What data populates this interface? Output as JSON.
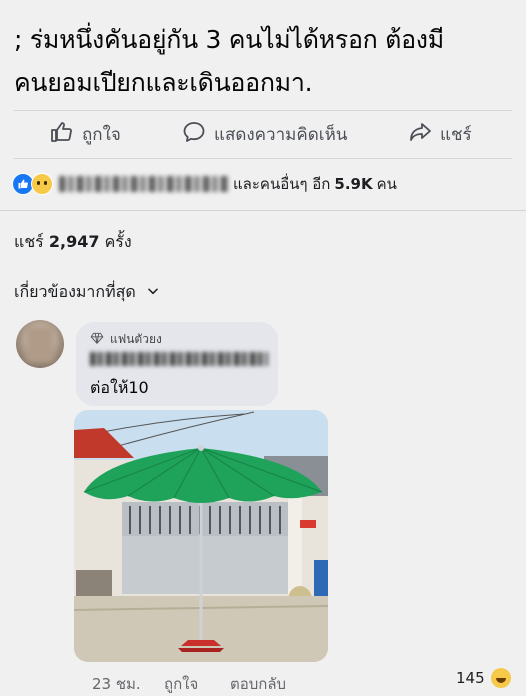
{
  "post": {
    "text_line1": "; ร่มหนึ่งคันอยู่กัน 3 คนไม่ได้หรอก ต้องมี",
    "text_line2": "คนยอมเปียกและเดินออกมา."
  },
  "actions": {
    "like_label": "ถูกใจ",
    "comment_label": "แสดงความคิดเห็น",
    "share_label": "แชร์"
  },
  "reactions": {
    "suffix": "และคนอื่นๆ อีก",
    "count": "5.9K",
    "unit": "คน",
    "icons": [
      "like-reaction",
      "sad-reaction"
    ]
  },
  "shares": {
    "label": "แชร์",
    "count": "2,947",
    "unit": "ครั้ง"
  },
  "filter": {
    "label": "เกี่ยวข้องมากที่สุด"
  },
  "comment": {
    "badge": "แฟนตัวยง",
    "text": "ต่อให้10",
    "time": "23 ชม.",
    "like_label": "ถูกใจ",
    "reply_label": "ตอบกลับ",
    "reaction_count": "145",
    "reaction_icon": "laugh-reaction"
  },
  "colors": {
    "facebook_blue": "#1877f2",
    "umbrella_green": "#1fa35a",
    "background": "#f0f0f0"
  }
}
